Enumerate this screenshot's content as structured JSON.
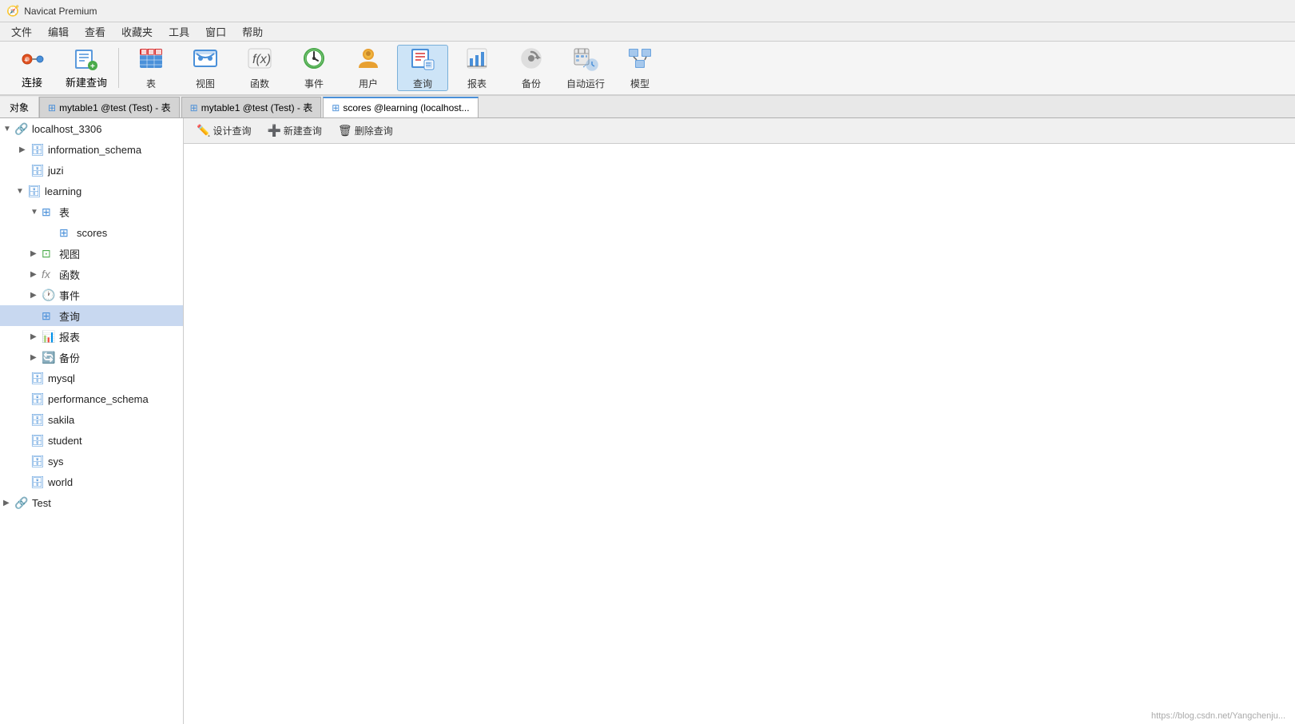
{
  "app": {
    "title": "Navicat Premium",
    "logo": "🧭"
  },
  "menubar": {
    "items": [
      "文件",
      "编辑",
      "查看",
      "收藏夹",
      "工具",
      "窗口",
      "帮助"
    ]
  },
  "toolbar": {
    "buttons": [
      {
        "id": "connect",
        "label": "连接",
        "icon": "connect"
      },
      {
        "id": "new-query",
        "label": "新建查询",
        "icon": "new-query"
      },
      {
        "id": "sep1",
        "type": "sep"
      },
      {
        "id": "table",
        "label": "表",
        "icon": "table"
      },
      {
        "id": "view",
        "label": "视图",
        "icon": "view"
      },
      {
        "id": "function",
        "label": "函数",
        "icon": "function"
      },
      {
        "id": "event",
        "label": "事件",
        "icon": "event"
      },
      {
        "id": "user",
        "label": "用户",
        "icon": "user"
      },
      {
        "id": "query",
        "label": "查询",
        "icon": "query",
        "active": true
      },
      {
        "id": "report",
        "label": "报表",
        "icon": "report"
      },
      {
        "id": "backup",
        "label": "备份",
        "icon": "backup"
      },
      {
        "id": "schedule",
        "label": "自动运行",
        "icon": "schedule"
      },
      {
        "id": "model",
        "label": "模型",
        "icon": "model"
      }
    ]
  },
  "tabs": {
    "object_tab": "对象",
    "items": [
      {
        "id": "tab1",
        "label": "mytable1 @test (Test) - 表",
        "active": false
      },
      {
        "id": "tab2",
        "label": "mytable1 @test (Test) - 表",
        "active": false
      },
      {
        "id": "tab3",
        "label": "scores @learning (localhost...",
        "active": true
      }
    ]
  },
  "content_toolbar": {
    "buttons": [
      {
        "id": "design-query",
        "label": "设计查询",
        "icon": "✏️"
      },
      {
        "id": "new-query",
        "label": "新建查询",
        "icon": "➕"
      },
      {
        "id": "delete-query",
        "label": "删除查询",
        "icon": "🗑️"
      }
    ]
  },
  "sidebar": {
    "servers": [
      {
        "id": "localhost_3306",
        "label": "localhost_3306",
        "expanded": true,
        "icon": "server-green",
        "databases": [
          {
            "id": "information_schema",
            "label": "information_schema",
            "expanded": false
          },
          {
            "id": "juzi",
            "label": "juzi",
            "expanded": false
          },
          {
            "id": "learning",
            "label": "learning",
            "expanded": true,
            "children": [
              {
                "id": "tables",
                "label": "表",
                "expanded": true,
                "icon": "table",
                "children": [
                  {
                    "id": "scores",
                    "label": "scores",
                    "icon": "table"
                  }
                ]
              },
              {
                "id": "views",
                "label": "视图",
                "expanded": false,
                "icon": "view"
              },
              {
                "id": "functions",
                "label": "函数",
                "expanded": false,
                "icon": "function"
              },
              {
                "id": "events",
                "label": "事件",
                "expanded": false,
                "icon": "event"
              },
              {
                "id": "queries",
                "label": "查询",
                "expanded": false,
                "icon": "query",
                "selected": true
              },
              {
                "id": "reports",
                "label": "报表",
                "expanded": false,
                "icon": "report"
              },
              {
                "id": "backups",
                "label": "备份",
                "expanded": false,
                "icon": "backup"
              }
            ]
          },
          {
            "id": "mysql",
            "label": "mysql",
            "expanded": false
          },
          {
            "id": "performance_schema",
            "label": "performance_schema",
            "expanded": false
          },
          {
            "id": "sakila",
            "label": "sakila",
            "expanded": false
          },
          {
            "id": "student",
            "label": "student",
            "expanded": false
          },
          {
            "id": "sys",
            "label": "sys",
            "expanded": false
          },
          {
            "id": "world",
            "label": "world",
            "expanded": false
          }
        ]
      },
      {
        "id": "Test",
        "label": "Test",
        "expanded": false,
        "icon": "server-orange"
      }
    ]
  },
  "watermark": "https://blog.csdn.net/Yangchenju..."
}
